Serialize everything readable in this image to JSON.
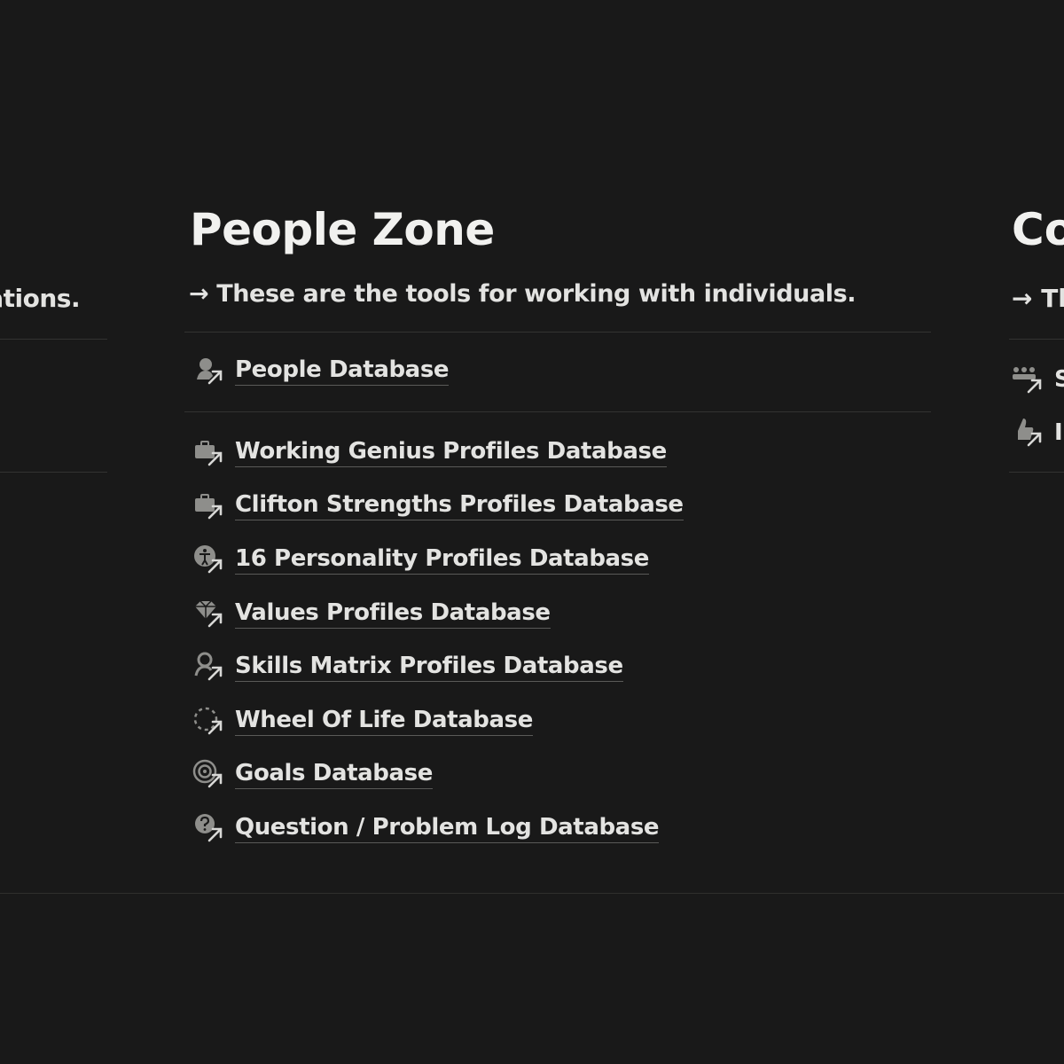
{
  "left_column": {
    "description_fragment": "isations."
  },
  "people_zone": {
    "title": "People Zone",
    "description": "→ These are the tools for working with individuals.",
    "primary_links": [
      {
        "label": "People Database",
        "icon": "person-speaking-icon"
      }
    ],
    "secondary_links": [
      {
        "label": "Working Genius Profiles Database",
        "icon": "briefcase-icon"
      },
      {
        "label": "Clifton Strengths Profiles Database",
        "icon": "briefcase-icon"
      },
      {
        "label": "16 Personality Profiles Database",
        "icon": "accessibility-icon"
      },
      {
        "label": "Values Profiles Database",
        "icon": "gem-icon"
      },
      {
        "label": "Skills Matrix Profiles Database",
        "icon": "person-search-icon"
      },
      {
        "label": "Wheel Of Life Database",
        "icon": "dashed-circle-icon"
      },
      {
        "label": "Goals Database",
        "icon": "target-icon"
      },
      {
        "label": "Question / Problem Log Database",
        "icon": "question-bubble-icon"
      }
    ]
  },
  "right_column": {
    "title_fragment": "Co",
    "description_fragment": "→ Th",
    "links": [
      {
        "label": "S",
        "icon": "group-icon"
      },
      {
        "label": "I",
        "icon": "thumbs-up-icon"
      }
    ]
  },
  "colors": {
    "background": "#191919",
    "text": "#e3e3e1",
    "divider": "#333331",
    "icon": "#8e8e8b"
  }
}
